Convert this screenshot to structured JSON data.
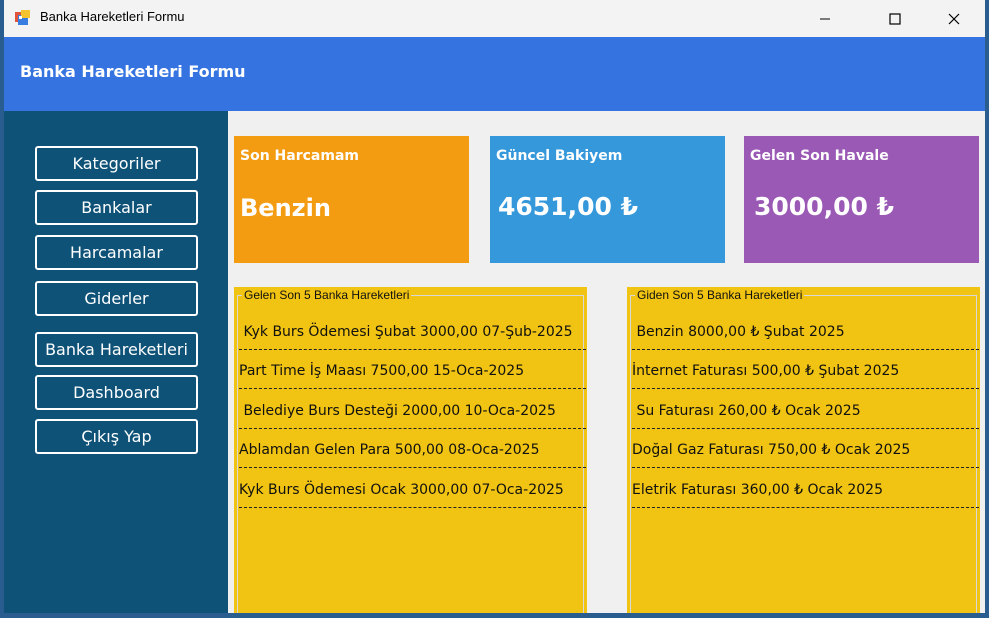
{
  "window": {
    "title": "Banka Hareketleri Formu"
  },
  "header": {
    "title": "Banka Hareketleri Formu"
  },
  "sidebar": {
    "items": [
      {
        "label": "Kategoriler"
      },
      {
        "label": "Bankalar"
      },
      {
        "label": "Harcamalar"
      },
      {
        "label": "Giderler"
      },
      {
        "label": "Banka Hareketleri"
      },
      {
        "label": "Dashboard"
      },
      {
        "label": "Çıkış Yap"
      }
    ]
  },
  "cards": {
    "last_expense": {
      "label": "Son Harcamam",
      "value": "Benzin",
      "color": "#f39c12"
    },
    "balance": {
      "label": "Güncel Bakiyem",
      "value": "4651,00 ₺",
      "color": "#3498db"
    },
    "last_transfer": {
      "label": "Gelen Son Havale",
      "value": "3000,00 ₺",
      "color": "#9b59b6"
    }
  },
  "incoming": {
    "title": "Gelen Son 5 Banka Hareketleri",
    "items": [
      " Kyk Burs Ödemesi Şubat 3000,00 07-Şub-2025",
      "Part Time İş Maası 7500,00 15-Oca-2025",
      " Belediye Burs Desteği 2000,00 10-Oca-2025",
      "Ablamdan Gelen Para 500,00 08-Oca-2025",
      "Kyk Burs Ödemesi Ocak 3000,00 07-Oca-2025"
    ]
  },
  "outgoing": {
    "title": "Giden Son 5 Banka Hareketleri",
    "items": [
      " Benzin 8000,00 ₺ Şubat 2025",
      "İnternet Faturası 500,00 ₺ Şubat 2025",
      " Su Faturası 260,00 ₺ Ocak 2025",
      "Doğal Gaz Faturası 750,00 ₺ Ocak 2025",
      "Eletrik Faturası 360,00 ₺ Ocak 2025"
    ]
  },
  "colors": {
    "header": "#3574e0",
    "sidebar": "#0f5278",
    "panel": "#f1c312"
  }
}
